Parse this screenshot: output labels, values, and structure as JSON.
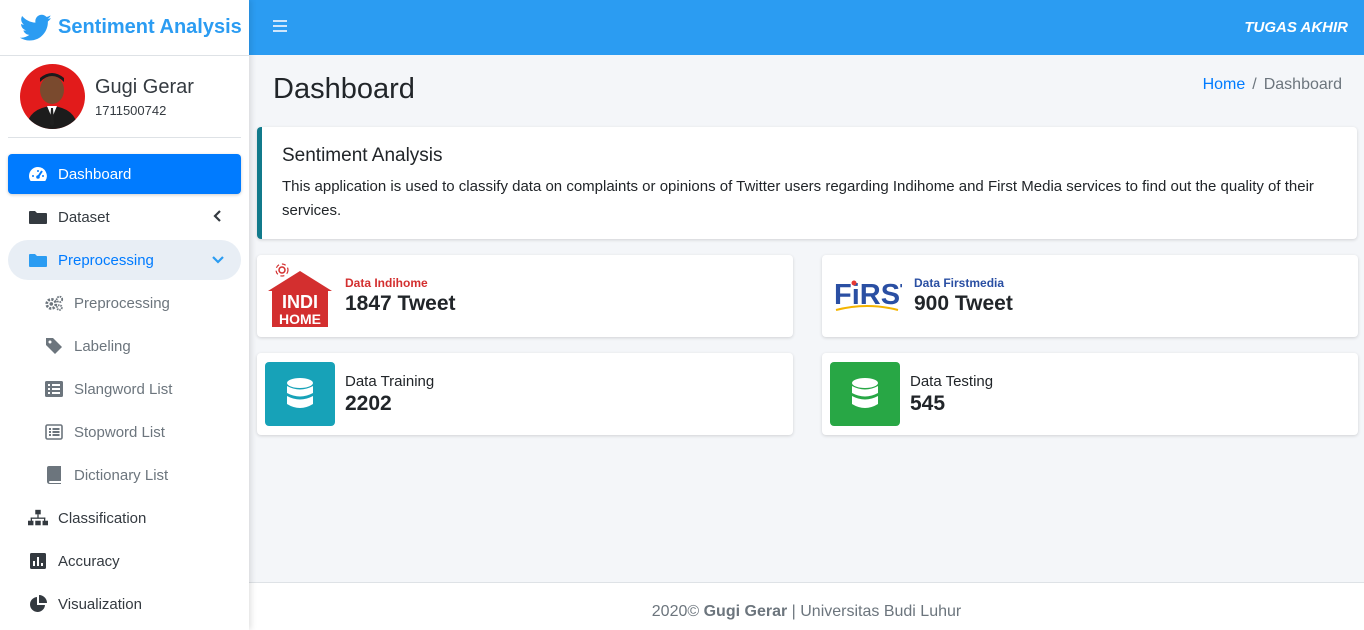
{
  "brand": {
    "title": "Sentiment Analysis",
    "icon": "twitter-bird-icon",
    "color": "#2b9cf2"
  },
  "user": {
    "name": "Gugi Gerar",
    "id": "1711500742"
  },
  "header": {
    "menu_icon": "hamburger-icon",
    "title": "TUGAS AKHIR"
  },
  "sidebar": {
    "items": [
      {
        "label": "Dashboard",
        "icon": "tachometer-icon",
        "state": "active"
      },
      {
        "label": "Dataset",
        "icon": "folder-icon",
        "state": "collapsed"
      },
      {
        "label": "Preprocessing",
        "icon": "folder-icon",
        "state": "open"
      },
      {
        "label": "Preprocessing",
        "icon": "cogs-icon"
      },
      {
        "label": "Labeling",
        "icon": "tag-icon"
      },
      {
        "label": "Slangword List",
        "icon": "list-icon"
      },
      {
        "label": "Stopword List",
        "icon": "list-alt-icon"
      },
      {
        "label": "Dictionary List",
        "icon": "book-icon"
      },
      {
        "label": "Classification",
        "icon": "sitemap-icon"
      },
      {
        "label": "Accuracy",
        "icon": "bar-chart-icon"
      },
      {
        "label": "Visualization",
        "icon": "pie-chart-icon"
      }
    ]
  },
  "page": {
    "title": "Dashboard",
    "breadcrumb": {
      "home": "Home",
      "separator": "/",
      "current": "Dashboard"
    }
  },
  "callout": {
    "title": "Sentiment Analysis",
    "text": "This application is used to classify data on complaints or opinions of Twitter users regarding Indihome and First Media services to find out the quality of their services."
  },
  "boxes": {
    "indihome": {
      "label": "Data Indihome",
      "value": "1847 Tweet",
      "logo_text": "INDI HOME",
      "logo_line1": "INDI",
      "logo_line2": "HOME"
    },
    "firstmedia": {
      "label": "Data Firstmedia",
      "value": "900 Tweet",
      "logo_text": "FIRST MEDIA",
      "logo_word": "FiRST"
    },
    "training": {
      "label": "Data Training",
      "value": "2202",
      "icon": "database-icon",
      "color": "#17a2b8"
    },
    "testing": {
      "label": "Data Testing",
      "value": "545",
      "icon": "database-icon",
      "color": "#28a745"
    }
  },
  "footer": {
    "year": "2020©",
    "author": "Gugi Gerar",
    "separator": "|",
    "institution": "Universitas Budi Luhur"
  }
}
